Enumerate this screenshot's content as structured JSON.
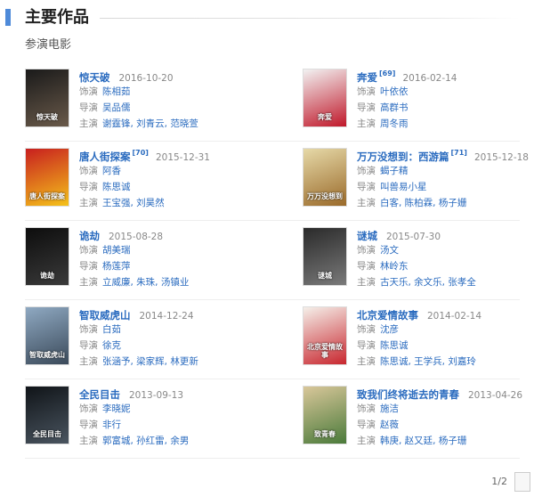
{
  "header": {
    "title": "主要作品"
  },
  "section": {
    "title": "参演电影"
  },
  "labels": {
    "role": "饰演",
    "director": "导演",
    "cast": "主演"
  },
  "colors": {
    "accent": "#4e8ad9",
    "link": "#2a6bbf"
  },
  "movies": [
    {
      "title": "惊天破",
      "ref": "",
      "date": "2016-10-20",
      "role": "陈相茹",
      "director": "吴品儒",
      "cast": "谢霆锋, 刘青云, 范晓萱",
      "poster_text": "惊天破",
      "poster_colors": [
        "#1a1a1a",
        "#6a5a4a"
      ]
    },
    {
      "title": "奔爱",
      "ref": "[69]",
      "date": "2016-02-14",
      "role": "叶依依",
      "director": "高群书",
      "cast": "周冬雨",
      "poster_text": "奔爱",
      "poster_colors": [
        "#f2f2f2",
        "#c0182a"
      ]
    },
    {
      "title": "唐人街探案",
      "ref": "[70]",
      "date": "2015-12-31",
      "role": "阿香",
      "director": "陈思诚",
      "cast": "王宝强, 刘昊然",
      "poster_text": "唐人街探案",
      "poster_colors": [
        "#c81f1f",
        "#f4c21a"
      ]
    },
    {
      "title": "万万没想到：西游篇",
      "ref": "[71]",
      "date": "2015-12-18",
      "role": "蝎子精",
      "director": "叫兽易小星",
      "cast": "白客, 陈柏霖, 杨子姗",
      "poster_text": "万万没想到",
      "poster_colors": [
        "#e6d9a8",
        "#9a6a2a"
      ]
    },
    {
      "title": "诡劫",
      "ref": "",
      "date": "2015-08-28",
      "role": "胡美瑞",
      "director": "杨莲萍",
      "cast": "立威廉, 朱珠, 汤镇业",
      "poster_text": "诡劫",
      "poster_colors": [
        "#0d0d0d",
        "#3a3a3a"
      ]
    },
    {
      "title": "谜城",
      "ref": "",
      "date": "2015-07-30",
      "role": "汤文",
      "director": "林岭东",
      "cast": "古天乐, 余文乐, 张孝全",
      "poster_text": "谜城",
      "poster_colors": [
        "#2a2a2a",
        "#7a7a7a"
      ]
    },
    {
      "title": "智取威虎山",
      "ref": "",
      "date": "2014-12-24",
      "role": "白茹",
      "director": "徐克",
      "cast": "张涵予, 梁家辉, 林更新",
      "poster_text": "智取威虎山",
      "poster_colors": [
        "#8fa9c2",
        "#3b4a5a"
      ]
    },
    {
      "title": "北京爱情故事",
      "ref": "",
      "date": "2014-02-14",
      "role": "沈彦",
      "director": "陈思诚",
      "cast": "陈思诚, 王学兵, 刘嘉玲",
      "poster_text": "北京爱情故事",
      "poster_colors": [
        "#f5f0ea",
        "#c8262e"
      ]
    },
    {
      "title": "全民目击",
      "ref": "",
      "date": "2013-09-13",
      "role": "李晓妮",
      "director": "非行",
      "cast": "郭富城, 孙红雷, 余男",
      "poster_text": "全民目击",
      "poster_colors": [
        "#101418",
        "#4a5560"
      ]
    },
    {
      "title": "致我们终将逝去的青春",
      "ref": "",
      "date": "2013-04-26",
      "role": "施洁",
      "director": "赵薇",
      "cast": "韩庚, 赵又廷, 杨子珊",
      "poster_text": "致青春",
      "poster_colors": [
        "#d9c79a",
        "#4a7a3a"
      ]
    }
  ],
  "pager": {
    "text": "1/2"
  }
}
